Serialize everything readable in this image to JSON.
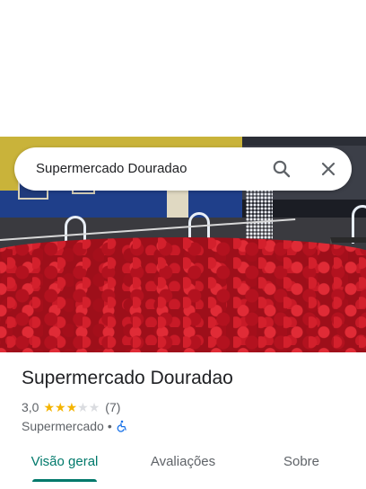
{
  "search": {
    "query": "Supermercado Douradao",
    "search_icon": "search-icon",
    "close_icon": "close-icon"
  },
  "place": {
    "name": "Supermercado Douradao",
    "rating": "3,0",
    "rating_stars": 3,
    "rating_max": 5,
    "reviews": "(7)",
    "category": "Supermercado",
    "separator": "•",
    "accessibility_icon": "wheelchair-icon"
  },
  "tabs": [
    {
      "label": "Visão geral",
      "active": true
    },
    {
      "label": "Avaliações",
      "active": false
    },
    {
      "label": "Sobre",
      "active": false
    }
  ],
  "colors": {
    "accent": "#00796b",
    "star": "#f4b400",
    "star_empty": "#dadce0",
    "accessibility": "#1a73e8"
  }
}
